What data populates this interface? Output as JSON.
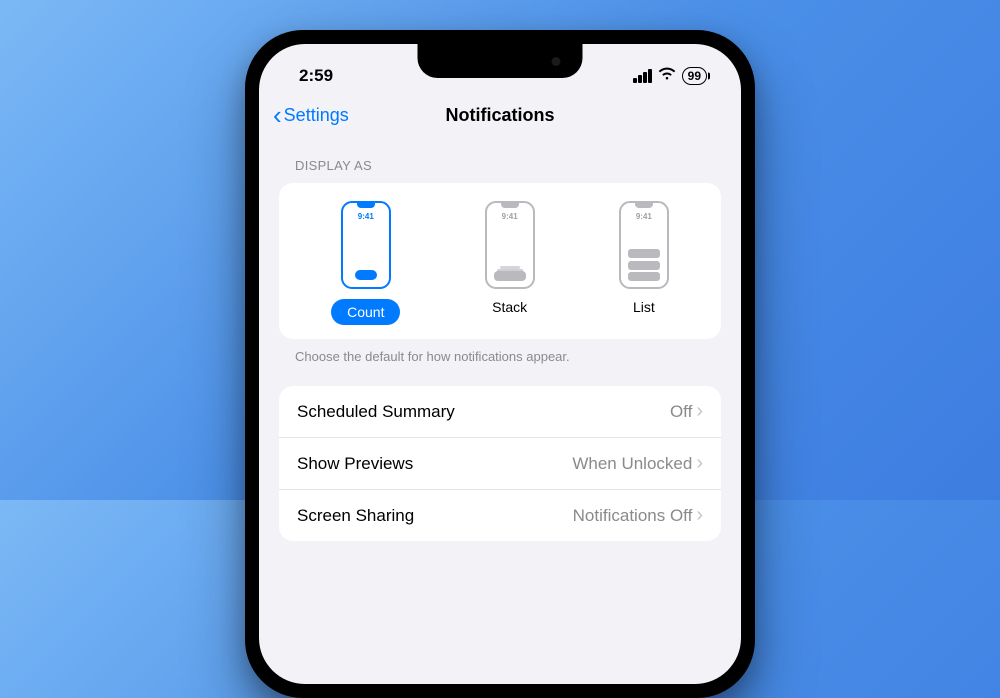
{
  "status": {
    "time": "2:59",
    "battery": "99"
  },
  "nav": {
    "back": "Settings",
    "title": "Notifications"
  },
  "displayAs": {
    "header": "DISPLAY AS",
    "miniTime": "9:41",
    "options": [
      {
        "label": "Count",
        "selected": true
      },
      {
        "label": "Stack",
        "selected": false
      },
      {
        "label": "List",
        "selected": false
      }
    ],
    "footer": "Choose the default for how notifications appear."
  },
  "rows": [
    {
      "label": "Scheduled Summary",
      "value": "Off"
    },
    {
      "label": "Show Previews",
      "value": "When Unlocked"
    },
    {
      "label": "Screen Sharing",
      "value": "Notifications Off"
    }
  ]
}
